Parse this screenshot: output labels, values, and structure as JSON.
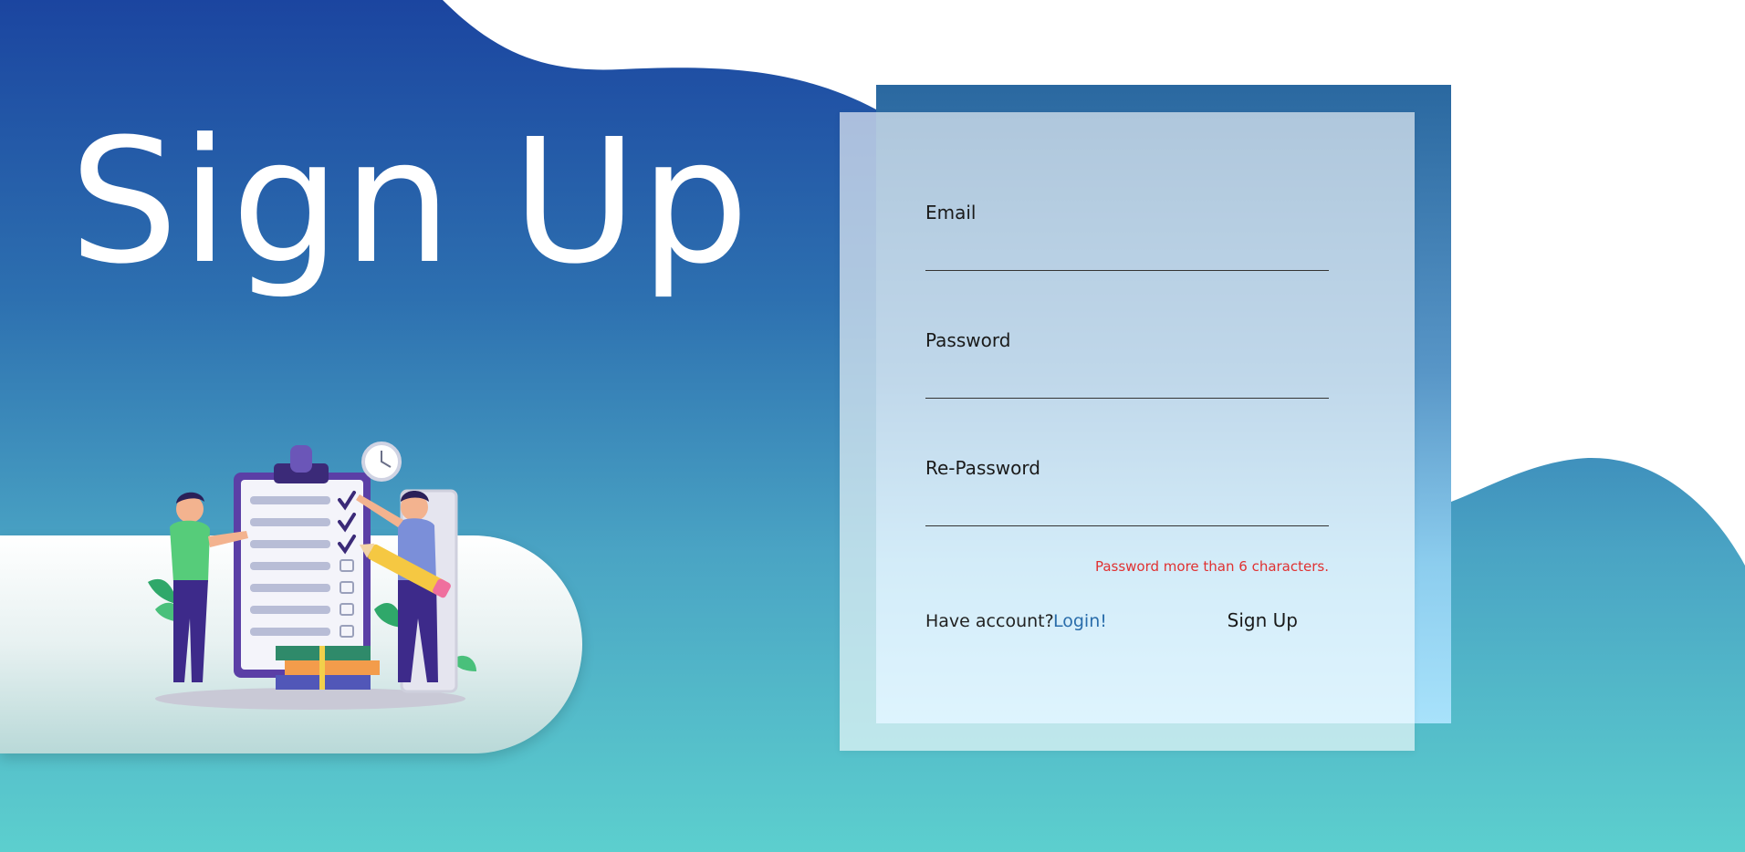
{
  "hero": {
    "title": "Sign Up"
  },
  "illustration": {
    "icon": "checklist-team-illustration"
  },
  "form": {
    "email_label": "Email",
    "email_value": "",
    "password_label": "Password",
    "password_value": "",
    "repassword_label": "Re-Password",
    "repassword_value": "",
    "error": "Password more than 6 characters.",
    "have_account": "Have account?",
    "login_link": "Login!",
    "submit": "Sign Up"
  },
  "colors": {
    "background_top": "#1b45a0",
    "background_bottom": "#5ccfce",
    "error": "#e03131",
    "link": "#2a6dab",
    "card_back_top": "#2a68a0",
    "card_back_bottom": "#a8e2fb"
  }
}
